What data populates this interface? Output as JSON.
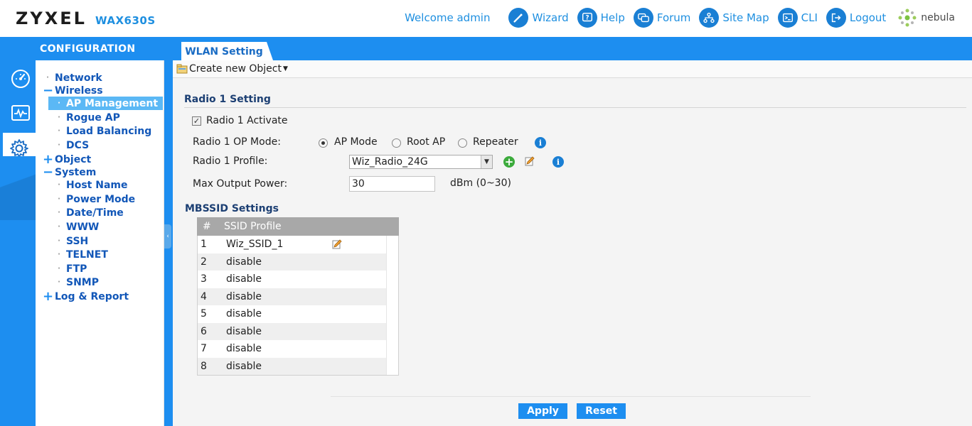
{
  "header": {
    "brand": "ZYXEL",
    "model": "WAX630S",
    "welcome": "Welcome admin",
    "links": {
      "wizard": "Wizard",
      "help": "Help",
      "forum": "Forum",
      "sitemap": "Site Map",
      "cli": "CLI",
      "logout": "Logout"
    },
    "nebula": "nebula"
  },
  "sidebar": {
    "title": "CONFIGURATION",
    "rail_icons": [
      "dashboard-icon",
      "monitor-icon",
      "configuration-icon",
      "maintenance-icon"
    ],
    "tree": {
      "network": "Network",
      "wireless": "Wireless",
      "ap_management": "AP Management",
      "rogue_ap": "Rogue AP",
      "load_balancing": "Load Balancing",
      "dcs": "DCS",
      "object": "Object",
      "system": "System",
      "host_name": "Host Name",
      "power_mode": "Power Mode",
      "date_time": "Date/Time",
      "www": "WWW",
      "ssh": "SSH",
      "telnet": "TELNET",
      "ftp": "FTP",
      "snmp": "SNMP",
      "log_report": "Log & Report"
    }
  },
  "tab": {
    "label": "WLAN Setting"
  },
  "toolbar": {
    "create_new_object": "Create new Object"
  },
  "radio1": {
    "section_title": "Radio 1 Setting",
    "activate_label": "Radio 1 Activate",
    "activate_checked": true,
    "op_mode_label": "Radio 1 OP Mode:",
    "op_mode_options": [
      "AP Mode",
      "Root AP",
      "Repeater"
    ],
    "op_mode_selected": "AP Mode",
    "profile_label": "Radio 1 Profile:",
    "profile_value": "Wiz_Radio_24G",
    "max_power_label": "Max Output Power:",
    "max_power_value": "30",
    "max_power_unit": "dBm (0~30)"
  },
  "mbssid": {
    "section_title": "MBSSID Settings",
    "columns": [
      "#",
      "SSID Profile"
    ],
    "rows": [
      {
        "num": "1",
        "profile": "Wiz_SSID_1"
      },
      {
        "num": "2",
        "profile": "disable"
      },
      {
        "num": "3",
        "profile": "disable"
      },
      {
        "num": "4",
        "profile": "disable"
      },
      {
        "num": "5",
        "profile": "disable"
      },
      {
        "num": "6",
        "profile": "disable"
      },
      {
        "num": "7",
        "profile": "disable"
      },
      {
        "num": "8",
        "profile": "disable"
      }
    ]
  },
  "buttons": {
    "apply": "Apply",
    "reset": "Reset"
  },
  "colors": {
    "brand_blue": "#1d8ef0",
    "link_blue": "#1e8fe0",
    "tree_text": "#1257b8",
    "selected_bg": "#5bb8f5"
  }
}
